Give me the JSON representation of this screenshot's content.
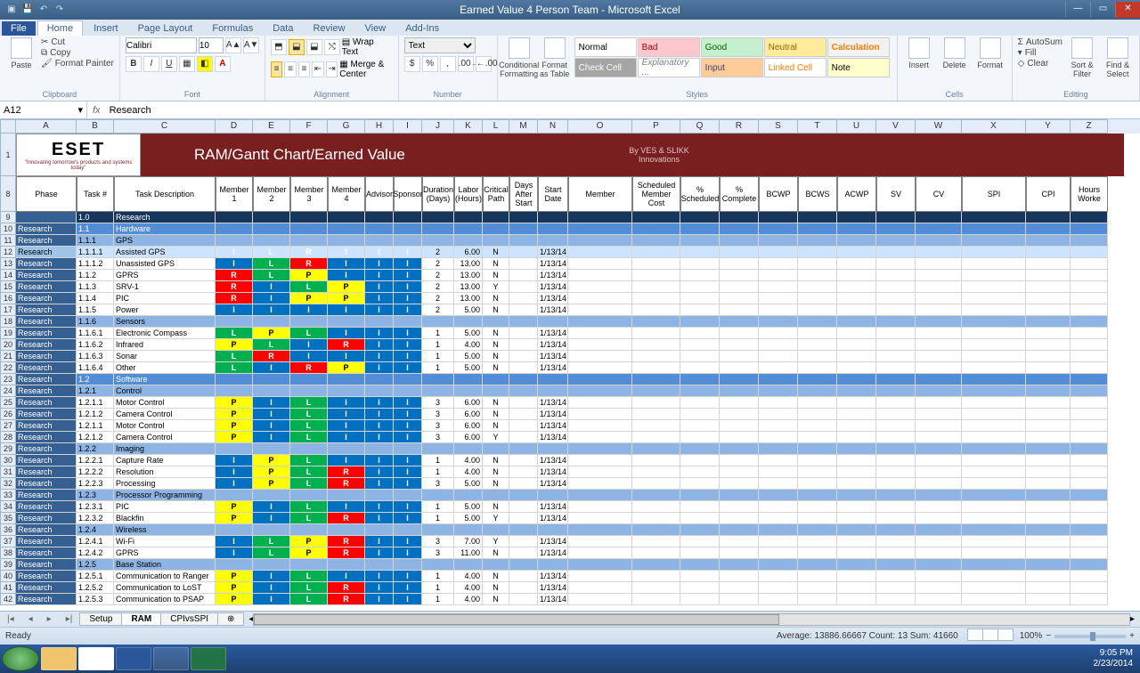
{
  "window": {
    "title": "Earned Value 4 Person Team - Microsoft Excel"
  },
  "tabs": {
    "file": "File",
    "active": "Home",
    "others": [
      "Insert",
      "Page Layout",
      "Formulas",
      "Data",
      "Review",
      "View",
      "Add-Ins"
    ]
  },
  "clipboard": {
    "label": "Clipboard",
    "paste": "Paste",
    "cut": "Cut",
    "copy": "Copy",
    "painter": "Format Painter"
  },
  "font": {
    "label": "Font",
    "name": "Calibri",
    "size": "10"
  },
  "alignment": {
    "label": "Alignment",
    "wrap": "Wrap Text",
    "merge": "Merge & Center"
  },
  "number": {
    "label": "Number",
    "format": "Text"
  },
  "stylesgrp": {
    "label": "Styles",
    "cond": "Conditional Formatting",
    "astable": "Format as Table",
    "items": [
      "Normal",
      "Bad",
      "Good",
      "Neutral",
      "Calculation",
      "Check Cell",
      "Explanatory ...",
      "Input",
      "Linked Cell",
      "Note"
    ]
  },
  "cells": {
    "label": "Cells",
    "insert": "Insert",
    "delete": "Delete",
    "format": "Format"
  },
  "editing": {
    "label": "Editing",
    "autosum": "AutoSum",
    "fill": "Fill",
    "clear": "Clear",
    "sort": "Sort & Filter",
    "find": "Find & Select"
  },
  "namebox": "A12",
  "formula": "Research",
  "cols": [
    "A",
    "B",
    "C",
    "D",
    "E",
    "F",
    "G",
    "H",
    "I",
    "J",
    "K",
    "L",
    "M",
    "N",
    "O",
    "P",
    "Q",
    "R",
    "S",
    "T",
    "U",
    "V",
    "W",
    "X",
    "Y",
    "Z"
  ],
  "brand": {
    "logo": "ESET",
    "tag": "\"Innovating tomorrow's products and systems today\"",
    "title": "RAM/Gantt Chart/Earned Value",
    "by": "By VES & SLIKK",
    "by2": "Innovations"
  },
  "headers": [
    "Phase",
    "Task #",
    "Task Description",
    "Member 1",
    "Member 2",
    "Member 3",
    "Member 4",
    "Advisor",
    "Sponsor",
    "Duration (Days)",
    "Labor (Hours)",
    "Critical Path",
    "Days After Start",
    "Start Date",
    "Member",
    "Scheduled Member Cost",
    "% Scheduled",
    "% Complete",
    "BCWP",
    "BCWS",
    "ACWP",
    "SV",
    "CV",
    "SPI",
    "CPI",
    "Hours Worke"
  ],
  "rows": [
    {
      "r": 9,
      "sec": "A",
      "phase": "",
      "task": "1.0",
      "desc": "Research"
    },
    {
      "r": 10,
      "sec": "B",
      "phase": "Research",
      "task": "1.1",
      "desc": "Hardware"
    },
    {
      "r": 11,
      "sec": "C",
      "phase": "Research",
      "task": "1.1.1",
      "desc": "GPS"
    },
    {
      "r": 12,
      "sel": true,
      "phase": "Research",
      "task": "1.1.1.1",
      "desc": "Assisted GPS",
      "m": [
        "I",
        "L",
        "R",
        "I",
        "I",
        "I"
      ],
      "dur": "2",
      "lab": "6.00",
      "crit": "N",
      "start": "1/13/14"
    },
    {
      "r": 13,
      "phase": "Research",
      "task": "1.1.1.2",
      "desc": "Unassisted GPS",
      "m": [
        "I",
        "L",
        "R",
        "I",
        "I",
        "I"
      ],
      "dur": "2",
      "lab": "13.00",
      "crit": "N",
      "start": "1/13/14"
    },
    {
      "r": 14,
      "phase": "Research",
      "task": "1.1.2",
      "desc": "GPRS",
      "m": [
        "R",
        "L",
        "P",
        "I",
        "I",
        "I"
      ],
      "dur": "2",
      "lab": "13.00",
      "crit": "N",
      "start": "1/13/14"
    },
    {
      "r": 15,
      "phase": "Research",
      "task": "1.1.3",
      "desc": "SRV-1",
      "m": [
        "R",
        "I",
        "L",
        "P",
        "I",
        "I"
      ],
      "dur": "2",
      "lab": "13.00",
      "crit": "Y",
      "start": "1/13/14"
    },
    {
      "r": 16,
      "phase": "Research",
      "task": "1.1.4",
      "desc": "PIC",
      "m": [
        "R",
        "I",
        "P",
        "P",
        "I",
        "I"
      ],
      "dur": "2",
      "lab": "13.00",
      "crit": "N",
      "start": "1/13/14"
    },
    {
      "r": 17,
      "phase": "Research",
      "task": "1.1.5",
      "desc": "Power",
      "m": [
        "I",
        "I",
        "I",
        "I",
        "I",
        "I"
      ],
      "dur": "2",
      "lab": "5.00",
      "crit": "N",
      "start": "1/13/14"
    },
    {
      "r": 18,
      "sec": "C",
      "phase": "Research",
      "task": "1.1.6",
      "desc": "Sensors"
    },
    {
      "r": 19,
      "phase": "Research",
      "task": "1.1.6.1",
      "desc": "Electronic Compass",
      "m": [
        "L",
        "P",
        "L",
        "I",
        "I",
        "I"
      ],
      "dur": "1",
      "lab": "5.00",
      "crit": "N",
      "start": "1/13/14"
    },
    {
      "r": 20,
      "phase": "Research",
      "task": "1.1.6.2",
      "desc": "Infrared",
      "m": [
        "P",
        "L",
        "I",
        "R",
        "I",
        "I"
      ],
      "dur": "1",
      "lab": "4.00",
      "crit": "N",
      "start": "1/13/14"
    },
    {
      "r": 21,
      "phase": "Research",
      "task": "1.1.6.3",
      "desc": "Sonar",
      "m": [
        "L",
        "R",
        "I",
        "I",
        "I",
        "I"
      ],
      "dur": "1",
      "lab": "5.00",
      "crit": "N",
      "start": "1/13/14"
    },
    {
      "r": 22,
      "phase": "Research",
      "task": "1.1.6.4",
      "desc": "Other",
      "m": [
        "L",
        "I",
        "R",
        "P",
        "I",
        "I"
      ],
      "dur": "1",
      "lab": "5.00",
      "crit": "N",
      "start": "1/13/14"
    },
    {
      "r": 23,
      "sec": "B",
      "phase": "Research",
      "task": "1.2",
      "desc": "Software"
    },
    {
      "r": 24,
      "sec": "C",
      "phase": "Research",
      "task": "1.2.1",
      "desc": "Control"
    },
    {
      "r": 25,
      "phase": "Research",
      "task": "1.2.1.1",
      "desc": "Motor Control",
      "m": [
        "P",
        "I",
        "L",
        "I",
        "I",
        "I"
      ],
      "dur": "3",
      "lab": "6.00",
      "crit": "N",
      "start": "1/13/14"
    },
    {
      "r": 26,
      "phase": "Research",
      "task": "1.2.1.2",
      "desc": "Camera Control",
      "m": [
        "P",
        "I",
        "L",
        "I",
        "I",
        "I"
      ],
      "dur": "3",
      "lab": "6.00",
      "crit": "N",
      "start": "1/13/14"
    },
    {
      "r": 27,
      "phase": "Research",
      "task": "1.2.1.1",
      "desc": "Motor Control",
      "m": [
        "P",
        "I",
        "L",
        "I",
        "I",
        "I"
      ],
      "dur": "3",
      "lab": "6.00",
      "crit": "N",
      "start": "1/13/14"
    },
    {
      "r": 28,
      "phase": "Research",
      "task": "1.2.1.2",
      "desc": "Camera Control",
      "m": [
        "P",
        "I",
        "L",
        "I",
        "I",
        "I"
      ],
      "dur": "3",
      "lab": "6.00",
      "crit": "Y",
      "start": "1/13/14"
    },
    {
      "r": 29,
      "sec": "C",
      "phase": "Research",
      "task": "1.2.2",
      "desc": "Imaging"
    },
    {
      "r": 30,
      "phase": "Research",
      "task": "1.2.2.1",
      "desc": "Capture Rate",
      "m": [
        "I",
        "P",
        "L",
        "I",
        "I",
        "I"
      ],
      "dur": "1",
      "lab": "4.00",
      "crit": "N",
      "start": "1/13/14"
    },
    {
      "r": 31,
      "phase": "Research",
      "task": "1.2.2.2",
      "desc": "Resolution",
      "m": [
        "I",
        "P",
        "L",
        "R",
        "I",
        "I"
      ],
      "dur": "1",
      "lab": "4.00",
      "crit": "N",
      "start": "1/13/14"
    },
    {
      "r": 32,
      "phase": "Research",
      "task": "1.2.2.3",
      "desc": "Processing",
      "m": [
        "I",
        "P",
        "L",
        "R",
        "I",
        "I"
      ],
      "dur": "3",
      "lab": "5.00",
      "crit": "N",
      "start": "1/13/14"
    },
    {
      "r": 33,
      "sec": "C",
      "phase": "Research",
      "task": "1.2.3",
      "desc": "Processor Programming"
    },
    {
      "r": 34,
      "phase": "Research",
      "task": "1.2.3.1",
      "desc": "PIC",
      "m": [
        "P",
        "I",
        "L",
        "I",
        "I",
        "I"
      ],
      "dur": "1",
      "lab": "5.00",
      "crit": "N",
      "start": "1/13/14"
    },
    {
      "r": 35,
      "phase": "Research",
      "task": "1.2.3.2",
      "desc": "Blackfin",
      "m": [
        "P",
        "I",
        "L",
        "R",
        "I",
        "I"
      ],
      "dur": "1",
      "lab": "5.00",
      "crit": "Y",
      "start": "1/13/14"
    },
    {
      "r": 36,
      "sec": "C",
      "phase": "Research",
      "task": "1.2.4",
      "desc": "Wireless"
    },
    {
      "r": 37,
      "phase": "Research",
      "task": "1.2.4.1",
      "desc": "Wi-Fi",
      "m": [
        "I",
        "L",
        "P",
        "R",
        "I",
        "I"
      ],
      "dur": "3",
      "lab": "7.00",
      "crit": "Y",
      "start": "1/13/14"
    },
    {
      "r": 38,
      "phase": "Research",
      "task": "1.2.4.2",
      "desc": "GPRS",
      "m": [
        "I",
        "L",
        "P",
        "R",
        "I",
        "I"
      ],
      "dur": "3",
      "lab": "11.00",
      "crit": "N",
      "start": "1/13/14"
    },
    {
      "r": 39,
      "sec": "C",
      "phase": "Research",
      "task": "1.2.5",
      "desc": "Base Station"
    },
    {
      "r": 40,
      "phase": "Research",
      "task": "1.2.5.1",
      "desc": "Communication to Ranger",
      "m": [
        "P",
        "I",
        "L",
        "I",
        "I",
        "I"
      ],
      "dur": "1",
      "lab": "4.00",
      "crit": "N",
      "start": "1/13/14"
    },
    {
      "r": 41,
      "phase": "Research",
      "task": "1.2.5.2",
      "desc": "Communication to LoST",
      "m": [
        "P",
        "I",
        "L",
        "R",
        "I",
        "I"
      ],
      "dur": "1",
      "lab": "4.00",
      "crit": "N",
      "start": "1/13/14"
    },
    {
      "r": 42,
      "phase": "Research",
      "task": "1.2.5.3",
      "desc": "Communication to PSAP",
      "m": [
        "P",
        "I",
        "L",
        "R",
        "I",
        "I"
      ],
      "dur": "1",
      "lab": "4.00",
      "crit": "N",
      "start": "1/13/14"
    }
  ],
  "sheets": {
    "list": [
      "Setup",
      "RAM",
      "CPIvsSPI"
    ],
    "active": "RAM"
  },
  "status": {
    "ready": "Ready",
    "agg": "Average: 13886.66667    Count: 13    Sum: 41660",
    "zoom": "100%"
  },
  "clock": {
    "time": "9:05 PM",
    "date": "2/23/2014"
  }
}
